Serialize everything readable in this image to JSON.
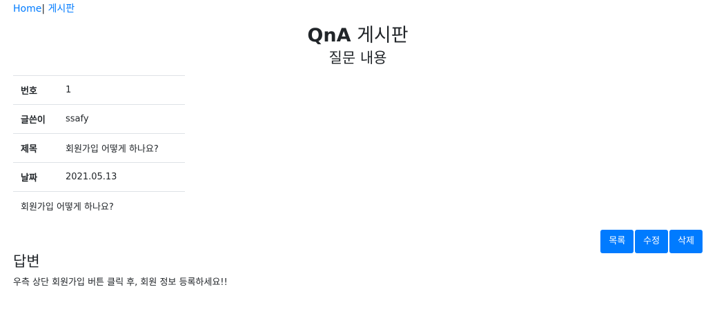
{
  "breadcrumb": {
    "home": "Home",
    "separator": "|",
    "board": "게시판"
  },
  "header": {
    "title_bold": "QnA",
    "title_rest": "게시판",
    "subtitle": "질문 내용"
  },
  "detail": {
    "rows": [
      {
        "key": "번호",
        "value": "1"
      },
      {
        "key": "글쓴이",
        "value": "ssafy"
      },
      {
        "key": "제목",
        "value": "회원가입 어떻게 하나요?"
      },
      {
        "key": "날짜",
        "value": "2021.05.13"
      }
    ],
    "content": "회원가입 어떻게 하나요?"
  },
  "actions": {
    "list_label": "목록",
    "edit_label": "수정",
    "delete_label": "삭제"
  },
  "answer": {
    "title": "답변",
    "text": "우측 상단 회원가입 버튼 클릭 후, 회원 정보 등록하세요!!"
  },
  "colors": {
    "primary": "#007bff",
    "border": "#dee2e6",
    "text": "#212529"
  }
}
